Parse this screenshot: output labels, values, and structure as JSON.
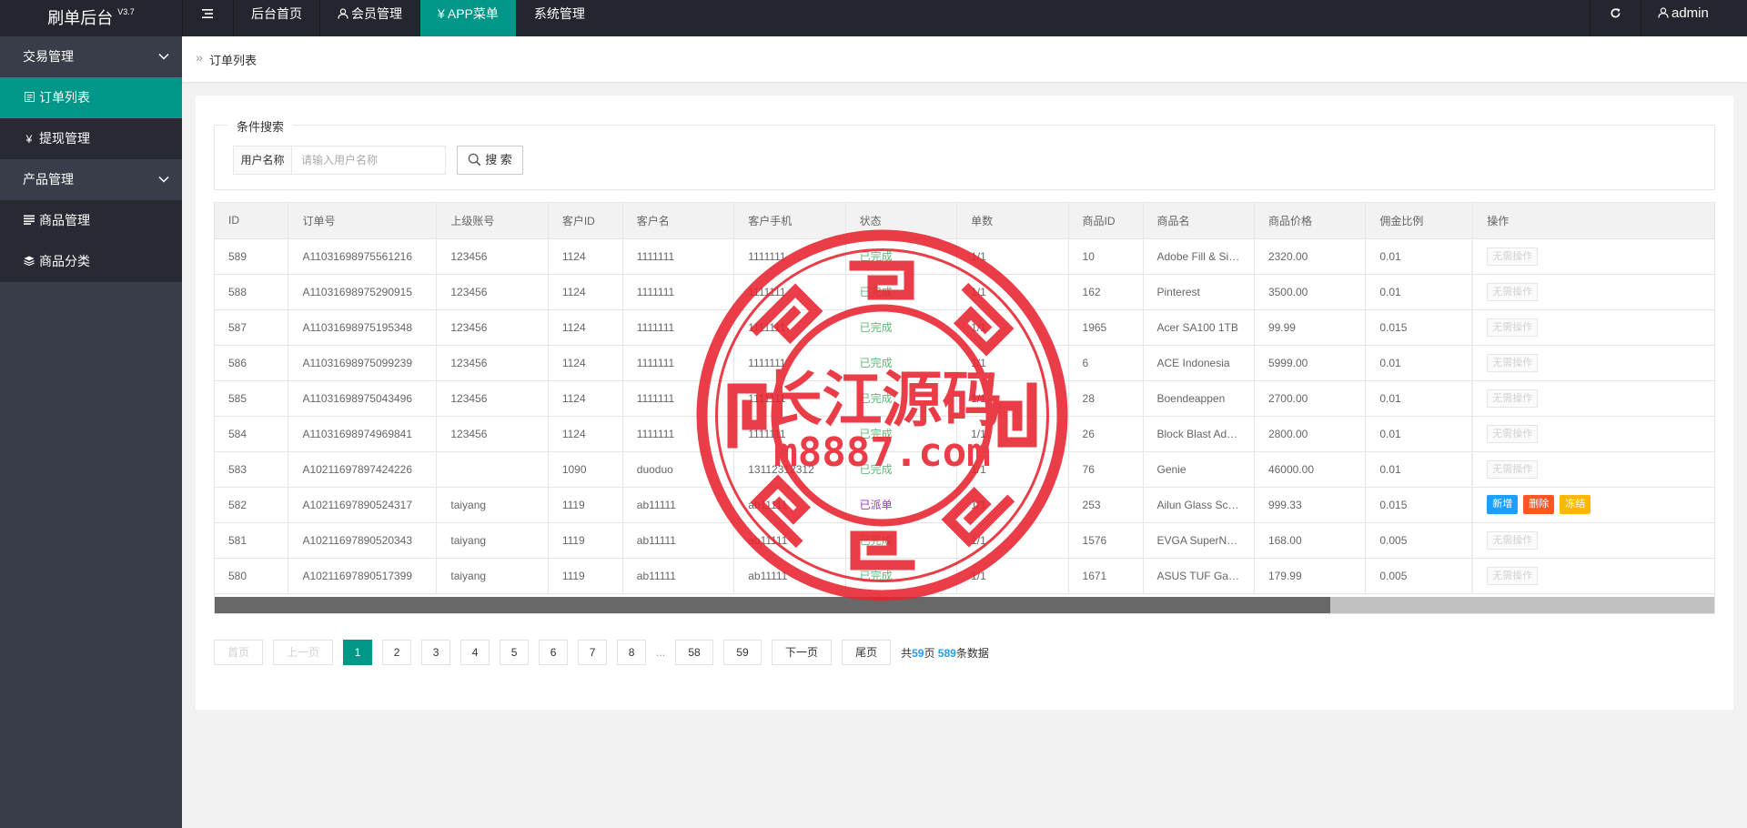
{
  "app": {
    "title": "刷单后台",
    "version": "V3.7"
  },
  "topnav": {
    "items": [
      {
        "label": "后台首页"
      },
      {
        "label": "会员管理"
      },
      {
        "label": "¥ APP菜单"
      },
      {
        "label": "系统管理"
      }
    ],
    "user": "admin"
  },
  "sidebar": {
    "groups": [
      {
        "label": "交易管理"
      },
      {
        "label": "产品管理"
      }
    ],
    "items": [
      {
        "label": "订单列表"
      },
      {
        "label": "提现管理"
      },
      {
        "label": "商品管理"
      },
      {
        "label": "商品分类"
      }
    ]
  },
  "breadcrumb": "订单列表",
  "search": {
    "legend": "条件搜索",
    "field_label": "用户名称",
    "placeholder": "请输入用户名称",
    "button": "搜 索"
  },
  "table": {
    "columns": [
      "ID",
      "订单号",
      "上级账号",
      "客户ID",
      "客户名",
      "客户手机",
      "状态",
      "单数",
      "商品ID",
      "商品名",
      "商品价格",
      "佣金比例",
      "操作"
    ],
    "rows": [
      [
        "589",
        "A11031698975561216",
        "123456",
        "1124",
        "1111111",
        "1111111",
        "已完成",
        "1/1",
        "10",
        "Adobe Fill & Sign",
        "2320.00",
        "0.01"
      ],
      [
        "588",
        "A11031698975290915",
        "123456",
        "1124",
        "1111111",
        "1111111",
        "已完成",
        "1/1",
        "162",
        "Pinterest",
        "3500.00",
        "0.01"
      ],
      [
        "587",
        "A11031698975195348",
        "123456",
        "1124",
        "1111111",
        "1111111",
        "已完成",
        "1/1",
        "1965",
        "Acer SA100 1TB",
        "99.99",
        "0.015"
      ],
      [
        "586",
        "A11031698975099239",
        "123456",
        "1124",
        "1111111",
        "1111111",
        "已完成",
        "1/1",
        "6",
        "ACE Indonesia",
        "5999.00",
        "0.01"
      ],
      [
        "585",
        "A11031698975043496",
        "123456",
        "1124",
        "1111111",
        "1111111",
        "已完成",
        "1/1",
        "28",
        "Boendeappen",
        "2700.00",
        "0.01"
      ],
      [
        "584",
        "A11031698974969841",
        "123456",
        "1124",
        "1111111",
        "1111111",
        "已完成",
        "1/1",
        "26",
        "Block Blast Adventure",
        "2800.00",
        "0.01"
      ],
      [
        "583",
        "A10211697897424226",
        "",
        "1090",
        "duoduo",
        "13112312312",
        "已完成",
        "1/1",
        "76",
        "Genie",
        "46000.00",
        "0.01"
      ],
      [
        "582",
        "A10211697890524317",
        "taiyang",
        "1119",
        "ab11111",
        "ab11111",
        "已派单",
        "1/1",
        "253",
        "Ailun Glass Screen",
        "999.33",
        "0.015"
      ],
      [
        "581",
        "A10211697890520343",
        "taiyang",
        "1119",
        "ab11111",
        "ab11111",
        "已完成",
        "1/1",
        "1576",
        "EVGA SuperNOVA",
        "168.00",
        "0.005"
      ],
      [
        "580",
        "A10211697890517399",
        "taiyang",
        "1119",
        "ab11111",
        "ab11111",
        "已完成",
        "1/1",
        "1671",
        "ASUS TUF Gaming",
        "179.99",
        "0.005"
      ]
    ],
    "no_action_label": "无需操作",
    "action_buttons": [
      {
        "label": "新增",
        "color": "#1e9fff"
      },
      {
        "label": "删除",
        "color": "#ff5722"
      },
      {
        "label": "冻结",
        "color": "#ffb800"
      }
    ],
    "colors": {
      "done": "#5fb878",
      "dispatched": "#a233c6"
    }
  },
  "pager": {
    "first": "首页",
    "prev": "上一页",
    "pages": [
      "1",
      "2",
      "3",
      "4",
      "5",
      "6",
      "7",
      "8"
    ],
    "ellipsis": "...",
    "tail_pages": [
      "58",
      "59"
    ],
    "next": "下一页",
    "last": "尾页",
    "info_prefix": "共",
    "total_pages": "59",
    "info_mid": "页 ",
    "total_items": "589",
    "info_suffix": "条数据"
  },
  "watermark": {
    "title": "长江源码",
    "url": "m8887.com",
    "color": "#e8232e"
  },
  "accent_color": "#009688"
}
